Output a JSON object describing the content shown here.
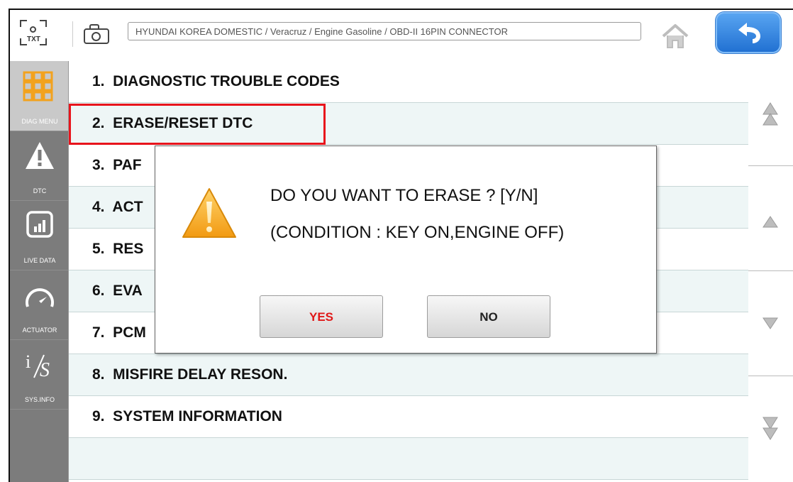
{
  "topbar": {
    "txt_label": "TXT",
    "path": "HYUNDAI KOREA DOMESTIC / Veracruz / Engine Gasoline / OBD-II 16PIN CONNECTOR",
    "icons": {
      "capture": "screen-capture-txt-icon",
      "camera": "camera-icon",
      "home": "home-icon",
      "back": "back-arrow-icon"
    },
    "back_color": "#2a7fe0"
  },
  "sidebar": {
    "items": [
      {
        "label": "DIAG MENU",
        "icon": "grid-icon",
        "active": true
      },
      {
        "label": "DTC",
        "icon": "warning-icon"
      },
      {
        "label": "LIVE DATA",
        "icon": "bar-chart-icon"
      },
      {
        "label": "ACTUATOR",
        "icon": "gauge-icon"
      },
      {
        "label": "SYS.INFO",
        "icon": "info-icon"
      }
    ]
  },
  "menu": {
    "items": [
      "1.  DIAGNOSTIC TROUBLE CODES",
      "2.  ERASE/RESET DTC",
      "3.  PAF",
      "4.  ACT",
      "5.  RES",
      "6.  EVA",
      "7.  PCM",
      "8.  MISFIRE DELAY RESON.",
      "9.  SYSTEM INFORMATION"
    ],
    "highlight_color": "#e8141c"
  },
  "scroll": {
    "icons": [
      "double-up-icon",
      "up-icon",
      "down-icon",
      "double-down-icon"
    ]
  },
  "dialog": {
    "line1": "DO YOU WANT TO ERASE ? [Y/N]",
    "line2": "(CONDITION : KEY ON,ENGINE OFF)",
    "yes": "YES",
    "no": "NO",
    "icon": "warning-triangle-icon",
    "yes_color": "#e01818"
  }
}
